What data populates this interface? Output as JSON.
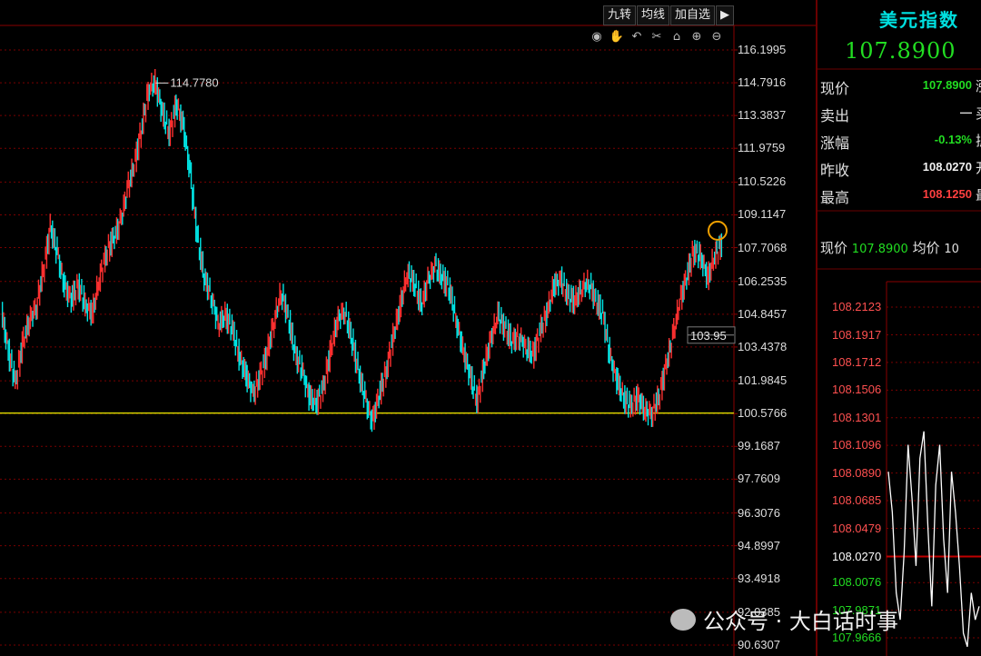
{
  "toolbar": {
    "buttons": [
      "九转",
      "均线",
      "加自选"
    ],
    "icons": [
      "eye-icon",
      "hand-icon",
      "undo-icon",
      "scissors-icon",
      "lock-icon",
      "zoom-in-icon",
      "zoom-out-icon"
    ]
  },
  "chart_data": {
    "type": "line",
    "y_ticks": [
      "116.1995",
      "114.7916",
      "113.3837",
      "111.9759",
      "110.5226",
      "109.1147",
      "107.7068",
      "106.2535",
      "104.8457",
      "103.4378",
      "101.9845",
      "100.5766",
      "99.1687",
      "97.7609",
      "96.3076",
      "94.8997",
      "93.4918",
      "92.0385",
      "90.6307"
    ],
    "ylim": [
      90.6307,
      116.1995
    ],
    "max_label": "114.7780",
    "price_tag": "103.95",
    "support_line": 100.6,
    "series": [
      {
        "values": [
          104.9,
          103.2,
          101.9,
          103.6,
          104.6,
          105.2,
          106.8,
          108.6,
          107.4,
          106.0,
          105.5,
          106.1,
          105.2,
          104.9,
          106.4,
          107.5,
          108.1,
          108.8,
          110.2,
          111.3,
          112.8,
          114.5,
          114.78,
          113.5,
          112.6,
          113.9,
          112.9,
          110.8,
          108.1,
          106.4,
          105.6,
          104.4,
          104.8,
          104.2,
          103.0,
          102.2,
          101.4,
          102.2,
          103.2,
          104.6,
          105.8,
          104.7,
          103.1,
          102.4,
          101.3,
          101.0,
          101.7,
          103.2,
          104.6,
          105.0,
          103.9,
          102.4,
          101.2,
          100.2,
          101.4,
          102.4,
          103.9,
          105.2,
          106.6,
          106.2,
          105.2,
          106.3,
          106.9,
          106.4,
          106.0,
          104.6,
          103.3,
          102.2,
          101.1,
          102.6,
          103.8,
          104.8,
          104.2,
          103.7,
          103.9,
          103.4,
          103.1,
          104.1,
          104.9,
          106.1,
          106.3,
          105.6,
          105.4,
          106.0,
          106.2,
          105.4,
          104.8,
          103.0,
          102.0,
          101.2,
          100.9,
          101.3,
          100.7,
          100.6,
          101.3,
          102.6,
          103.9,
          105.4,
          106.5,
          107.6,
          107.3,
          106.4,
          107.4,
          107.89
        ]
      }
    ]
  },
  "panel": {
    "title": "美元指数",
    "price": "107.8900",
    "quotes": [
      {
        "label": "现价",
        "value": "107.8900",
        "color": "#22dd22",
        "trail": "涨"
      },
      {
        "label": "卖出",
        "value": "—",
        "color": "#e0e0e0",
        "trail": "买"
      },
      {
        "label": "涨幅",
        "value": "-0.13%",
        "color": "#22dd22",
        "trail": "振"
      },
      {
        "label": "昨收",
        "value": "108.0270",
        "color": "#f0f0f0",
        "trail": "开"
      },
      {
        "label": "最高",
        "value": "108.1250",
        "color": "#ff4040",
        "trail": "最"
      }
    ],
    "line2": {
      "label1": "现价",
      "value1": "107.8900",
      "label2": "均价",
      "value2": "10"
    },
    "minute_ticks": [
      "108.2123",
      "108.1917",
      "108.1712",
      "108.1506",
      "108.1301",
      "108.1096",
      "108.0890",
      "108.0685",
      "108.0479",
      "108.0270",
      "108.0076",
      "107.9871",
      "107.9666"
    ],
    "minute_values": [
      108.09,
      108.06,
      108.0,
      107.98,
      108.03,
      108.11,
      108.07,
      108.02,
      108.1,
      108.12,
      108.05,
      107.99,
      108.08,
      108.11,
      108.04,
      108.0,
      108.09,
      108.06,
      108.02,
      107.97,
      107.96,
      108.0,
      107.98,
      107.99
    ]
  },
  "watermark": "公众号 · 大白话时事",
  "colors": {
    "up": "#ff3030",
    "down": "#00e5e5",
    "grid": "#7a0000",
    "support": "#d4d400",
    "circle": "#f0a000"
  }
}
